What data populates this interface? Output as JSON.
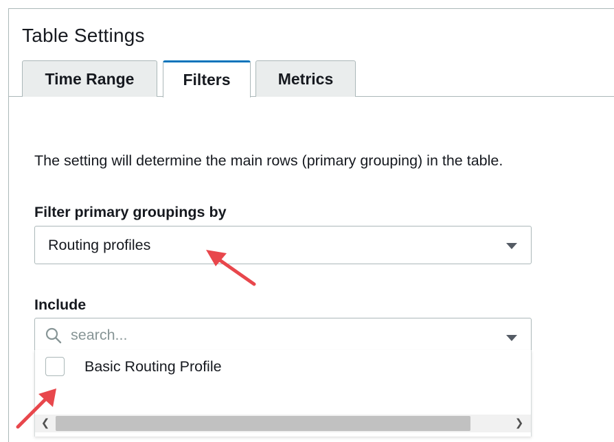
{
  "panel": {
    "title": "Table Settings"
  },
  "tabs": [
    {
      "label": "Time Range",
      "active": false
    },
    {
      "label": "Filters",
      "active": true
    },
    {
      "label": "Metrics",
      "active": false
    }
  ],
  "filters": {
    "description": "The setting will determine the main rows (primary grouping) in the table.",
    "filter_label": "Filter primary groupings by",
    "filter_value": "Routing profiles",
    "include_label": "Include",
    "search_placeholder": "search...",
    "options": [
      {
        "label": "Basic Routing Profile",
        "checked": false
      }
    ]
  },
  "icons": {
    "search": "search-icon",
    "caret": "caret-down-icon",
    "scroll_left": "chevron-left-icon",
    "scroll_right": "chevron-right-icon"
  },
  "colors": {
    "active_tab_accent": "#0073bb",
    "annotation_arrow": "#e8474c",
    "border": "#aab7b8"
  }
}
